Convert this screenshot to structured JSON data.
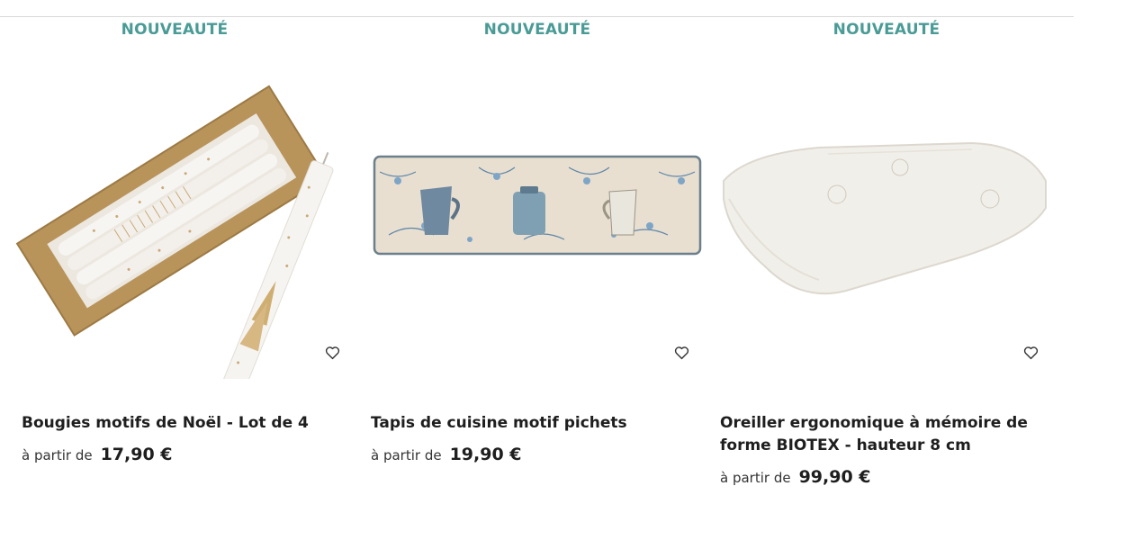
{
  "products": [
    {
      "badge": "NOUVEAUTÉ",
      "title": "Bougies motifs de Noël - Lot de 4",
      "from_label": "à partir de",
      "price": "17,90 €",
      "favorite_icon": "heart-icon"
    },
    {
      "badge": "NOUVEAUTÉ",
      "title": "Tapis de cuisine motif pichets",
      "from_label": "à partir de",
      "price": "19,90 €",
      "favorite_icon": "heart-icon"
    },
    {
      "badge": "NOUVEAUTÉ",
      "title": "Oreiller ergonomique à mémoire de forme BIOTEX - hauteur 8 cm",
      "from_label": "à partir de",
      "price": "99,90 €",
      "favorite_icon": "heart-icon"
    }
  ],
  "colors": {
    "badge": "#4a9b96",
    "text": "#1e1e1e",
    "divider": "#d9d9d9"
  }
}
